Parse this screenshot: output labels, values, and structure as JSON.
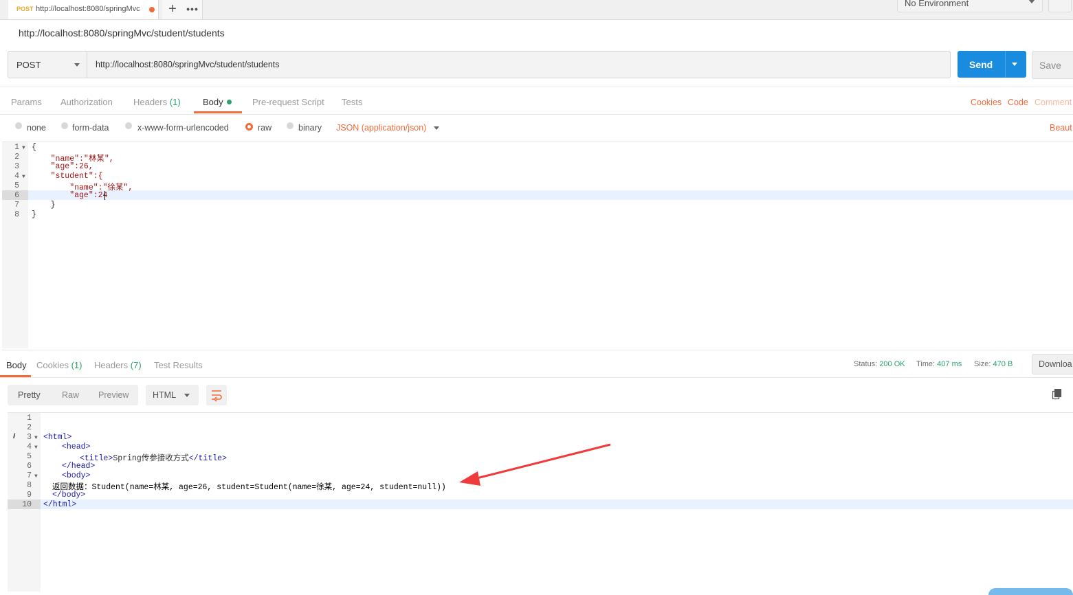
{
  "tabbar": {
    "tab_method": "POST",
    "tab_url": "http://localhost:8080/springMvc",
    "new_tab": "+",
    "more": "•••",
    "environment": "No Environment"
  },
  "page_title": "http://localhost:8080/springMvc/student/students",
  "request": {
    "method": "POST",
    "url": "http://localhost:8080/springMvc/student/students",
    "send_label": "Send",
    "save_label": "Save"
  },
  "request_tabs": {
    "params": "Params",
    "authorization": "Authorization",
    "headers": "Headers",
    "headers_count": "(1)",
    "body": "Body",
    "prerequest": "Pre-request Script",
    "tests": "Tests",
    "cookies": "Cookies",
    "code": "Code",
    "comments": "Comment"
  },
  "body_types": {
    "none": "none",
    "form_data": "form-data",
    "urlencoded": "x-www-form-urlencoded",
    "raw": "raw",
    "binary": "binary",
    "json_type": "JSON (application/json)",
    "beautify": "Beaut",
    "selected": "raw"
  },
  "request_body_lines": [
    "{",
    "    \"name\":\"林某\",",
    "    \"age\":26,",
    "    \"student\":{",
    "        \"name\":\"徐某\",",
    "        \"age\":24",
    "    }",
    "}"
  ],
  "response_tabs": {
    "body": "Body",
    "cookies": "Cookies",
    "cookies_count": "(1)",
    "headers": "Headers",
    "headers_count": "(7)",
    "test_results": "Test Results"
  },
  "status": {
    "status_label": "Status:",
    "status_value": "200 OK",
    "time_label": "Time:",
    "time_value": "407 ms",
    "size_label": "Size:",
    "size_value": "470 B",
    "download": "Downloa"
  },
  "response_toolbar": {
    "pretty": "Pretty",
    "raw": "Raw",
    "preview": "Preview",
    "format": "HTML"
  },
  "response_lines": {
    "l3": "<html>",
    "l4": "<head>",
    "l5_open": "<title>",
    "l5_text": "Spring传参接收方式",
    "l5_close": "</title>",
    "l6": "</head>",
    "l7": "<body>",
    "l8": "返回数据：Student(name=林某, age=26, student=Student(name=徐某, age=24, student=null))",
    "l9": "</body>",
    "l10": "</html>"
  },
  "colors": {
    "accent": "#f26b3a",
    "send": "#1a8ce0",
    "success": "#29a36a",
    "annotation_arrow": "#ee3b3b"
  }
}
